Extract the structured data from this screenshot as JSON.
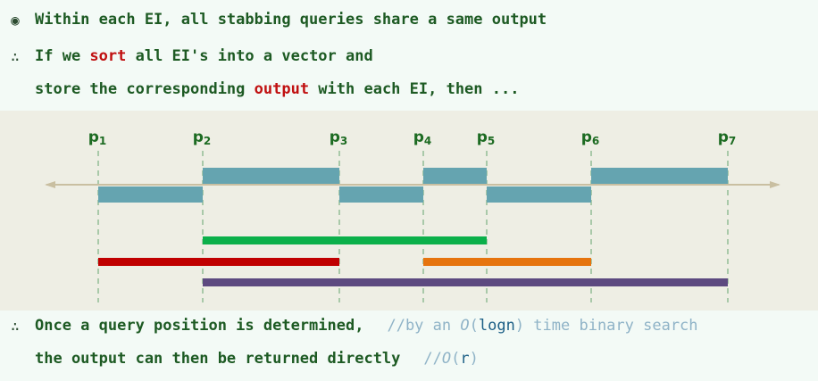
{
  "lines": {
    "l1": {
      "glyph": "◉",
      "text": "Within each EI, all stabbing queries share a same output"
    },
    "l2": {
      "glyph": "∴",
      "pre": "If we ",
      "kw": "sort",
      "post": " all EI's into a vector and"
    },
    "l3": {
      "pre": "store the corresponding ",
      "kw": "output",
      "post": " with each EI, then ..."
    },
    "l4": {
      "glyph": "∴",
      "text": "Once a query position is determined,",
      "c_pre": "//by an ",
      "c_o": "O",
      "c_paren_open": "(",
      "c_fn": "logn",
      "c_paren_close": ")",
      "c_post": " time binary search"
    },
    "l5": {
      "text": "the output can then be returned directly",
      "c_pre": "//",
      "c_o": "O",
      "c_paren_open": "(",
      "c_fn": "r",
      "c_paren_close": ")"
    }
  },
  "diagram": {
    "points": [
      {
        "base": "p",
        "sub": "1",
        "x": 1
      },
      {
        "base": "p",
        "sub": "2",
        "x": 2
      },
      {
        "base": "p",
        "sub": "3",
        "x": 3
      },
      {
        "base": "p",
        "sub": "4",
        "x": 4
      },
      {
        "base": "p",
        "sub": "5",
        "x": 5
      },
      {
        "base": "p",
        "sub": "6",
        "x": 6
      },
      {
        "base": "p",
        "sub": "7",
        "x": 7
      }
    ],
    "elementary_intervals": [
      {
        "from": 1,
        "to": 2,
        "row": "below"
      },
      {
        "from": 2,
        "to": 3,
        "row": "above"
      },
      {
        "from": 3,
        "to": 4,
        "row": "below"
      },
      {
        "from": 4,
        "to": 5,
        "row": "above"
      },
      {
        "from": 5,
        "to": 6,
        "row": "below"
      },
      {
        "from": 6,
        "to": 7,
        "row": "above"
      }
    ],
    "segments": [
      {
        "from": 2,
        "to": 5,
        "row": 0,
        "color": "#0bb04a"
      },
      {
        "from": 1,
        "to": 3,
        "row": 1,
        "color": "#c00000"
      },
      {
        "from": 4,
        "to": 6,
        "row": 1,
        "color": "#e6740e"
      },
      {
        "from": 2,
        "to": 7,
        "row": 2,
        "color": "#5d4a80"
      }
    ],
    "colors": {
      "ei": "#65a4b0",
      "axis": "#c9bfa1",
      "guide": "#a9c9a9",
      "label": "#1d6b22"
    }
  }
}
